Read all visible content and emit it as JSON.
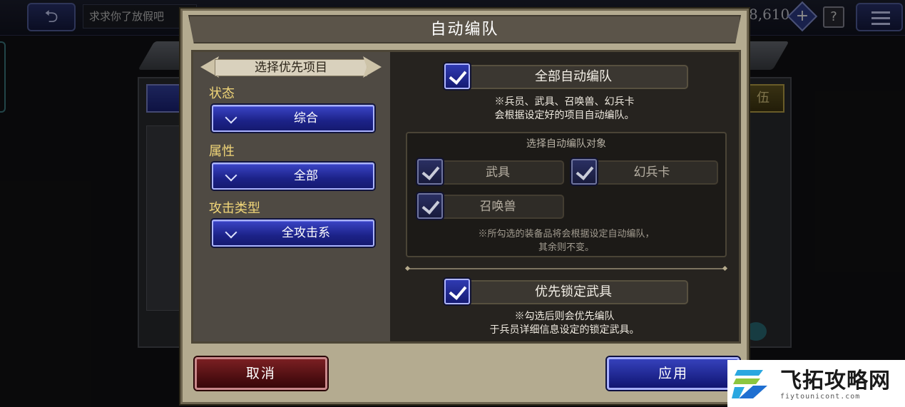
{
  "top_bar": {
    "back_icon": "back-arrow-icon",
    "message": "求求你了放假吧",
    "gem_count": "8,610",
    "plus_label": "+",
    "help_label": "?",
    "menu_icon": "hamburger-menu-icon"
  },
  "background": {
    "right_button_label": "伍"
  },
  "modal": {
    "title": "自动编队",
    "left": {
      "banner": "选择优先项目",
      "groups": [
        {
          "label": "状态",
          "value": "综合"
        },
        {
          "label": "属性",
          "value": "全部"
        },
        {
          "label": "攻击类型",
          "value": "全攻击系"
        }
      ]
    },
    "right": {
      "all_auto": {
        "label": "全部自动编队",
        "checked": true
      },
      "all_auto_note": [
        "※兵员、武具、召唤兽、幻兵卡",
        "会根据设定好的项目自动编队。"
      ],
      "target": {
        "title": "选择自动编队对象",
        "items": [
          {
            "label": "武具",
            "checked": true
          },
          {
            "label": "幻兵卡",
            "checked": true
          },
          {
            "label": "召唤兽",
            "checked": true
          }
        ],
        "note": [
          "※所勾选的装备品将会根据设定自动编队，",
          "其余则不变。"
        ]
      },
      "lock": {
        "label": "优先锁定武具",
        "checked": true
      },
      "lock_note": [
        "※勾选后则会优先编队",
        "于兵员详细信息设定的锁定武具。"
      ]
    },
    "buttons": {
      "cancel": "取消",
      "apply": "应用"
    }
  },
  "watermark": {
    "name": "飞拓攻略网",
    "url": "fiytounicont.com"
  },
  "colors": {
    "modal_frame": "#b4ab90",
    "label_yellow": "#f1d679",
    "button_blue": "#1c2288",
    "button_red": "#4a0d10"
  }
}
